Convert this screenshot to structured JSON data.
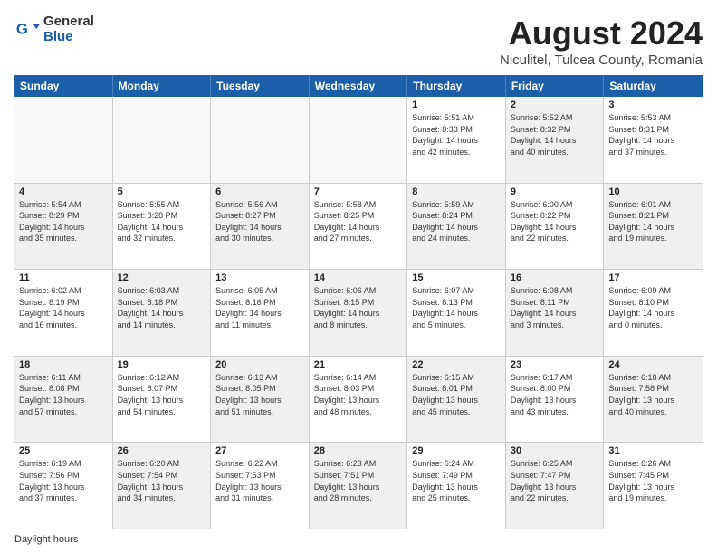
{
  "logo": {
    "general": "General",
    "blue": "Blue"
  },
  "title": "August 2024",
  "subtitle": "Niculitel, Tulcea County, Romania",
  "days_header": [
    "Sunday",
    "Monday",
    "Tuesday",
    "Wednesday",
    "Thursday",
    "Friday",
    "Saturday"
  ],
  "footer": "Daylight hours",
  "weeks": [
    [
      {
        "day": "",
        "info": "",
        "shaded": false,
        "empty": true
      },
      {
        "day": "",
        "info": "",
        "shaded": false,
        "empty": true
      },
      {
        "day": "",
        "info": "",
        "shaded": false,
        "empty": true
      },
      {
        "day": "",
        "info": "",
        "shaded": false,
        "empty": true
      },
      {
        "day": "1",
        "info": "Sunrise: 5:51 AM\nSunset: 8:33 PM\nDaylight: 14 hours\nand 42 minutes.",
        "shaded": false,
        "empty": false
      },
      {
        "day": "2",
        "info": "Sunrise: 5:52 AM\nSunset: 8:32 PM\nDaylight: 14 hours\nand 40 minutes.",
        "shaded": true,
        "empty": false
      },
      {
        "day": "3",
        "info": "Sunrise: 5:53 AM\nSunset: 8:31 PM\nDaylight: 14 hours\nand 37 minutes.",
        "shaded": false,
        "empty": false
      }
    ],
    [
      {
        "day": "4",
        "info": "Sunrise: 5:54 AM\nSunset: 8:29 PM\nDaylight: 14 hours\nand 35 minutes.",
        "shaded": true,
        "empty": false
      },
      {
        "day": "5",
        "info": "Sunrise: 5:55 AM\nSunset: 8:28 PM\nDaylight: 14 hours\nand 32 minutes.",
        "shaded": false,
        "empty": false
      },
      {
        "day": "6",
        "info": "Sunrise: 5:56 AM\nSunset: 8:27 PM\nDaylight: 14 hours\nand 30 minutes.",
        "shaded": true,
        "empty": false
      },
      {
        "day": "7",
        "info": "Sunrise: 5:58 AM\nSunset: 8:25 PM\nDaylight: 14 hours\nand 27 minutes.",
        "shaded": false,
        "empty": false
      },
      {
        "day": "8",
        "info": "Sunrise: 5:59 AM\nSunset: 8:24 PM\nDaylight: 14 hours\nand 24 minutes.",
        "shaded": true,
        "empty": false
      },
      {
        "day": "9",
        "info": "Sunrise: 6:00 AM\nSunset: 8:22 PM\nDaylight: 14 hours\nand 22 minutes.",
        "shaded": false,
        "empty": false
      },
      {
        "day": "10",
        "info": "Sunrise: 6:01 AM\nSunset: 8:21 PM\nDaylight: 14 hours\nand 19 minutes.",
        "shaded": true,
        "empty": false
      }
    ],
    [
      {
        "day": "11",
        "info": "Sunrise: 6:02 AM\nSunset: 8:19 PM\nDaylight: 14 hours\nand 16 minutes.",
        "shaded": false,
        "empty": false
      },
      {
        "day": "12",
        "info": "Sunrise: 6:03 AM\nSunset: 8:18 PM\nDaylight: 14 hours\nand 14 minutes.",
        "shaded": true,
        "empty": false
      },
      {
        "day": "13",
        "info": "Sunrise: 6:05 AM\nSunset: 8:16 PM\nDaylight: 14 hours\nand 11 minutes.",
        "shaded": false,
        "empty": false
      },
      {
        "day": "14",
        "info": "Sunrise: 6:06 AM\nSunset: 8:15 PM\nDaylight: 14 hours\nand 8 minutes.",
        "shaded": true,
        "empty": false
      },
      {
        "day": "15",
        "info": "Sunrise: 6:07 AM\nSunset: 8:13 PM\nDaylight: 14 hours\nand 5 minutes.",
        "shaded": false,
        "empty": false
      },
      {
        "day": "16",
        "info": "Sunrise: 6:08 AM\nSunset: 8:11 PM\nDaylight: 14 hours\nand 3 minutes.",
        "shaded": true,
        "empty": false
      },
      {
        "day": "17",
        "info": "Sunrise: 6:09 AM\nSunset: 8:10 PM\nDaylight: 14 hours\nand 0 minutes.",
        "shaded": false,
        "empty": false
      }
    ],
    [
      {
        "day": "18",
        "info": "Sunrise: 6:11 AM\nSunset: 8:08 PM\nDaylight: 13 hours\nand 57 minutes.",
        "shaded": true,
        "empty": false
      },
      {
        "day": "19",
        "info": "Sunrise: 6:12 AM\nSunset: 8:07 PM\nDaylight: 13 hours\nand 54 minutes.",
        "shaded": false,
        "empty": false
      },
      {
        "day": "20",
        "info": "Sunrise: 6:13 AM\nSunset: 8:05 PM\nDaylight: 13 hours\nand 51 minutes.",
        "shaded": true,
        "empty": false
      },
      {
        "day": "21",
        "info": "Sunrise: 6:14 AM\nSunset: 8:03 PM\nDaylight: 13 hours\nand 48 minutes.",
        "shaded": false,
        "empty": false
      },
      {
        "day": "22",
        "info": "Sunrise: 6:15 AM\nSunset: 8:01 PM\nDaylight: 13 hours\nand 45 minutes.",
        "shaded": true,
        "empty": false
      },
      {
        "day": "23",
        "info": "Sunrise: 6:17 AM\nSunset: 8:00 PM\nDaylight: 13 hours\nand 43 minutes.",
        "shaded": false,
        "empty": false
      },
      {
        "day": "24",
        "info": "Sunrise: 6:18 AM\nSunset: 7:58 PM\nDaylight: 13 hours\nand 40 minutes.",
        "shaded": true,
        "empty": false
      }
    ],
    [
      {
        "day": "25",
        "info": "Sunrise: 6:19 AM\nSunset: 7:56 PM\nDaylight: 13 hours\nand 37 minutes.",
        "shaded": false,
        "empty": false
      },
      {
        "day": "26",
        "info": "Sunrise: 6:20 AM\nSunset: 7:54 PM\nDaylight: 13 hours\nand 34 minutes.",
        "shaded": true,
        "empty": false
      },
      {
        "day": "27",
        "info": "Sunrise: 6:22 AM\nSunset: 7:53 PM\nDaylight: 13 hours\nand 31 minutes.",
        "shaded": false,
        "empty": false
      },
      {
        "day": "28",
        "info": "Sunrise: 6:23 AM\nSunset: 7:51 PM\nDaylight: 13 hours\nand 28 minutes.",
        "shaded": true,
        "empty": false
      },
      {
        "day": "29",
        "info": "Sunrise: 6:24 AM\nSunset: 7:49 PM\nDaylight: 13 hours\nand 25 minutes.",
        "shaded": false,
        "empty": false
      },
      {
        "day": "30",
        "info": "Sunrise: 6:25 AM\nSunset: 7:47 PM\nDaylight: 13 hours\nand 22 minutes.",
        "shaded": true,
        "empty": false
      },
      {
        "day": "31",
        "info": "Sunrise: 6:26 AM\nSunset: 7:45 PM\nDaylight: 13 hours\nand 19 minutes.",
        "shaded": false,
        "empty": false
      }
    ]
  ]
}
